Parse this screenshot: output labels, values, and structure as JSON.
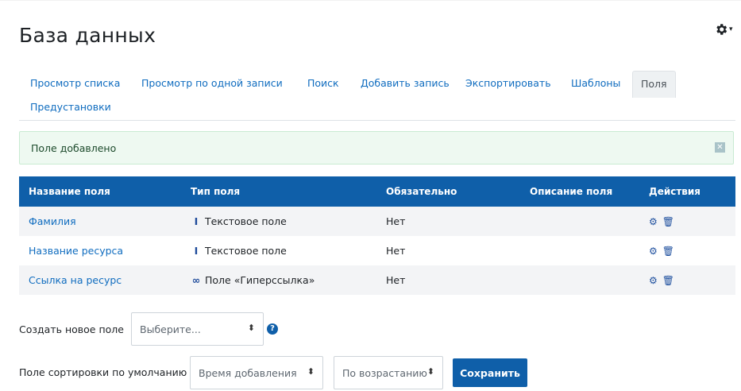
{
  "page": {
    "title": "База данных"
  },
  "tabs": [
    {
      "label": "Просмотр списка",
      "active": false
    },
    {
      "label": "Просмотр по одной записи",
      "active": false
    },
    {
      "label": "Поиск",
      "active": false
    },
    {
      "label": "Добавить запись",
      "active": false
    },
    {
      "label": "Экспортировать",
      "active": false
    },
    {
      "label": "Шаблоны",
      "active": false
    },
    {
      "label": "Поля",
      "active": true
    },
    {
      "label": "Предустановки",
      "active": false
    }
  ],
  "alert": {
    "text": "Поле добавлено",
    "close_symbol": "✕"
  },
  "table": {
    "headers": [
      "Название поля",
      "Тип поля",
      "Обязательно",
      "Описание поля",
      "Действия"
    ],
    "rows": [
      {
        "name": "Фамилия",
        "type": "Текстовое поле",
        "type_icon": "text-cursor-icon",
        "required": "Нет",
        "description": ""
      },
      {
        "name": "Название ресурса",
        "type": "Текстовое поле",
        "type_icon": "text-cursor-icon",
        "required": "Нет",
        "description": ""
      },
      {
        "name": "Ссылка на ресурс",
        "type": "Поле «Гиперссылка»",
        "type_icon": "link-icon",
        "required": "Нет",
        "description": ""
      }
    ]
  },
  "new_field": {
    "label": "Создать новое поле",
    "selected": "Выберите..."
  },
  "sort": {
    "label": "Поле сортировки по умолчанию",
    "field_selected": "Время добавления",
    "order_selected": "По возрастанию",
    "save_label": "Сохранить"
  },
  "colors": {
    "accent": "#0f5fa9",
    "link": "#0f6cbf",
    "success_bg": "#eef9f1"
  }
}
